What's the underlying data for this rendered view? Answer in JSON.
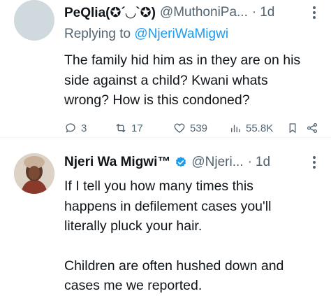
{
  "tweets": [
    {
      "author_name": "PeQlia(✪´◡`✪)",
      "handle": "@MuthoniPa...",
      "separator": "·",
      "time": "1d",
      "replying_prefix": "Replying to ",
      "replying_to": "@NjeriWaMigwi",
      "body": [
        "The family hid him as in they are on his side against a child? Kwani whats wrong? How is this condoned?"
      ],
      "actions": {
        "replies": "3",
        "retweets": "17",
        "likes": "539",
        "views": "55.8K"
      }
    },
    {
      "author_name": "Njeri Wa Migwi™",
      "handle": "@Njeri...",
      "separator": "·",
      "time": "1d",
      "body": [
        "If I tell you how many times this happens in defilement cases you'll literally pluck your hair.",
        "Children are often hushed down and cases me we reported."
      ]
    }
  ],
  "icons": {
    "reply": "reply-icon",
    "retweet": "retweet-icon",
    "like": "heart-icon",
    "views": "views-icon",
    "bookmark": "bookmark-icon",
    "share": "share-icon",
    "verified": "verified-badge-icon",
    "more": "more-icon"
  },
  "colors": {
    "accent": "#1d9bf0",
    "text": "#0f1419",
    "secondary": "#536471"
  }
}
